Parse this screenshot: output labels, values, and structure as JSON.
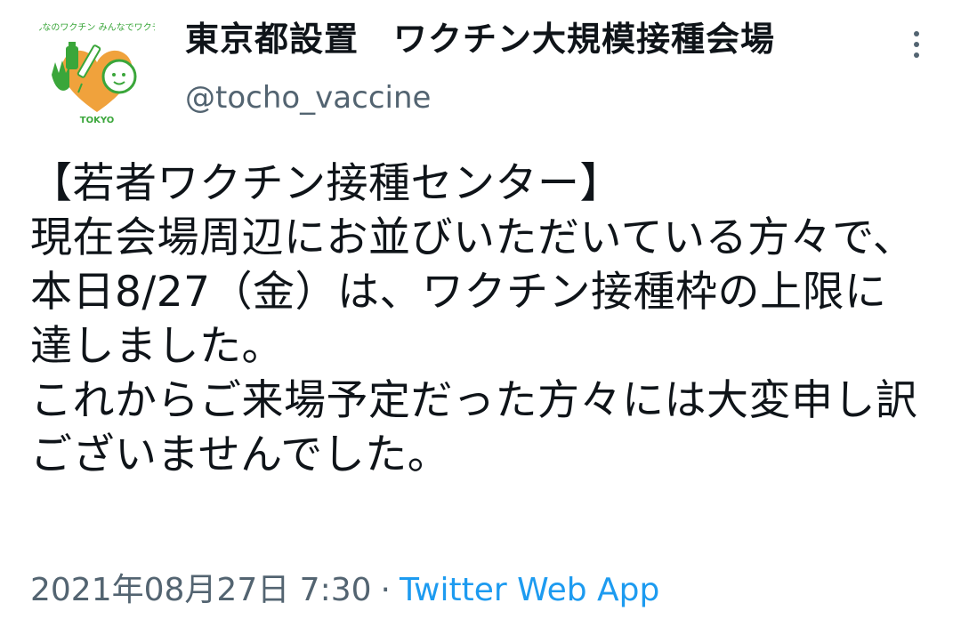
{
  "profile": {
    "display_name": "東京都設置　ワクチン大規模接種会場",
    "handle": "@tocho_vaccine",
    "avatar_text_top": "みんなのワクチン みんなでワクチン",
    "avatar_text_bottom": "TOKYO",
    "avatar_icon": "tokyo-vaccine-logo",
    "accent_green": "#3aa63a",
    "accent_orange": "#f0a23c"
  },
  "tweet": {
    "text": "【若者ワクチン接種センター】\n現在会場周辺にお並びいただいている方々で、本日8/27（金）は、ワクチン接種枠の上限に達しました。\nこれからご来場予定だった方々には大変申し訳ございませんでした。",
    "timestamp": "2021年08月27日 7:30",
    "separator": "·",
    "source": "Twitter Web App"
  },
  "menu": {
    "icon": "more-vertical-icon"
  },
  "colors": {
    "text": "#0f1419",
    "secondary": "#536471",
    "link": "#1d9bf0"
  }
}
